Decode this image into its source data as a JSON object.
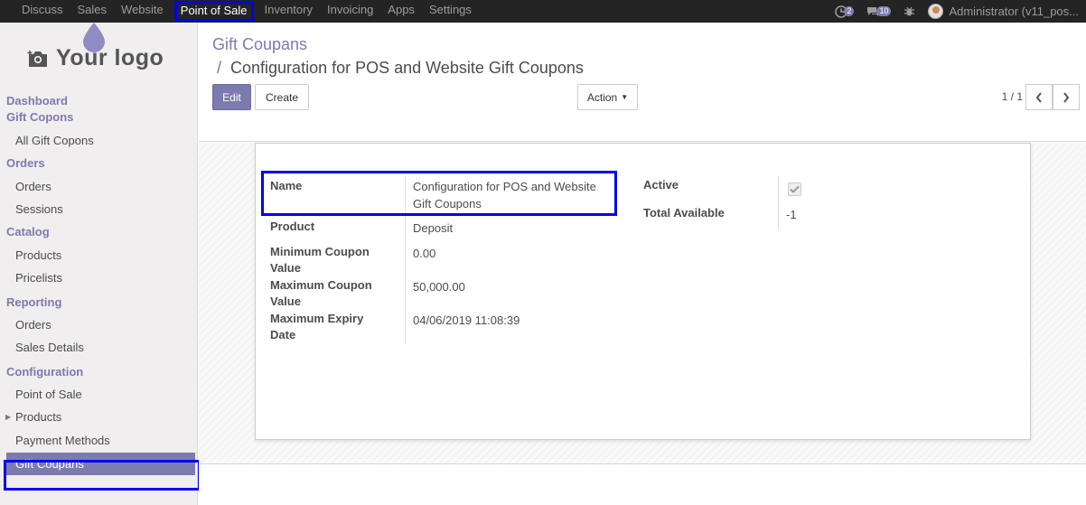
{
  "topnav": {
    "items": [
      "Discuss",
      "Sales",
      "Website",
      "Point of Sale",
      "Inventory",
      "Invoicing",
      "Apps",
      "Settings"
    ],
    "active_index": 3,
    "activity_count": "2",
    "messages_count": "10",
    "user_name": "Administrator (v11_pos..."
  },
  "logo": {
    "text": "Your logo"
  },
  "sidebar": {
    "sections": [
      {
        "title": "Dashboard",
        "items": []
      },
      {
        "title": "Gift Copons",
        "items": [
          "All Gift Copons"
        ]
      },
      {
        "title": "Orders",
        "items": [
          "Orders",
          "Sessions"
        ]
      },
      {
        "title": "Catalog",
        "items": [
          "Products",
          "Pricelists"
        ]
      },
      {
        "title": "Reporting",
        "items": [
          "Orders",
          "Sales Details"
        ]
      },
      {
        "title": "Configuration",
        "items": [
          "Point of Sale",
          "Products",
          "Payment Methods",
          "Gift Coupans"
        ]
      }
    ]
  },
  "breadcrumb": {
    "parent": "Gift Coupans",
    "current": "Configuration for POS and Website Gift Coupons"
  },
  "buttons": {
    "edit": "Edit",
    "create": "Create",
    "action": "Action"
  },
  "pager": {
    "value": "1 / 1"
  },
  "form": {
    "name_label": "Name",
    "name_value_line1": "Configuration for POS and Website",
    "name_value_line2": "Gift Coupons",
    "product_label": "Product",
    "product_value": "Deposit",
    "min_label_1": "Minimum Coupon",
    "min_label_2": "Value",
    "min_value": "0.00",
    "max_label_1": "Maximum Coupon",
    "max_label_2": "Value",
    "max_value": "50,000.00",
    "expiry_label_1": "Maximum Expiry",
    "expiry_label_2": "Date",
    "expiry_value": "04/06/2019 11:08:39",
    "active_label": "Active",
    "active_checked": true,
    "total_label": "Total Available",
    "total_value": "-1"
  },
  "colors": {
    "brand": "#7c7bad",
    "navbar": "#242424",
    "highlight": "#0000ee"
  }
}
